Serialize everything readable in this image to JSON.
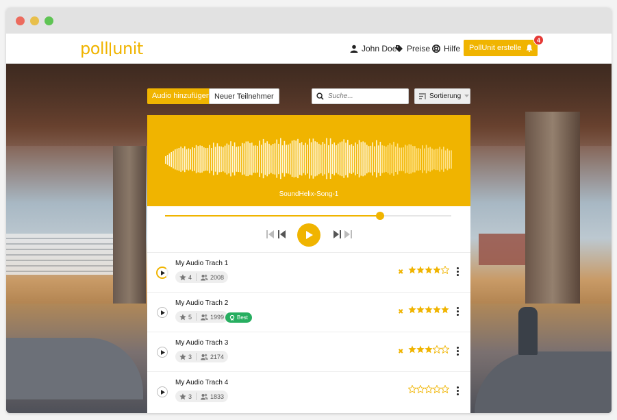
{
  "app": {
    "logo_left": "poll",
    "logo_right": "unit"
  },
  "nav": {
    "user": "John Doe",
    "prices": "Preise",
    "help": "Hilfe",
    "create": "PollUnit erstellen",
    "notifications_count": "4"
  },
  "toolbar": {
    "add_audio": "Audio hinzufügen",
    "new_participant": "Neuer Teilnehmer",
    "search_placeholder": "Suche...",
    "sort_label": "Sortierung"
  },
  "player": {
    "song_title": "SoundHelix-Song-1",
    "progress": 0.75,
    "accent": "#f0b400"
  },
  "tracks": [
    {
      "name": "My Audio Trach 1",
      "stars": "4",
      "participants": "2008",
      "rating": 4,
      "best": false,
      "active": true
    },
    {
      "name": "My Audio Trach 2",
      "stars": "5",
      "participants": "1999",
      "rating": 5,
      "best": true,
      "active": false
    },
    {
      "name": "My Audio Trach 3",
      "stars": "3",
      "participants": "2174",
      "rating": 3,
      "best": false,
      "active": false
    },
    {
      "name": "My Audio Trach 4",
      "stars": "3",
      "participants": "1833",
      "rating": 0,
      "best": false,
      "active": false
    }
  ],
  "best_label": "Best"
}
